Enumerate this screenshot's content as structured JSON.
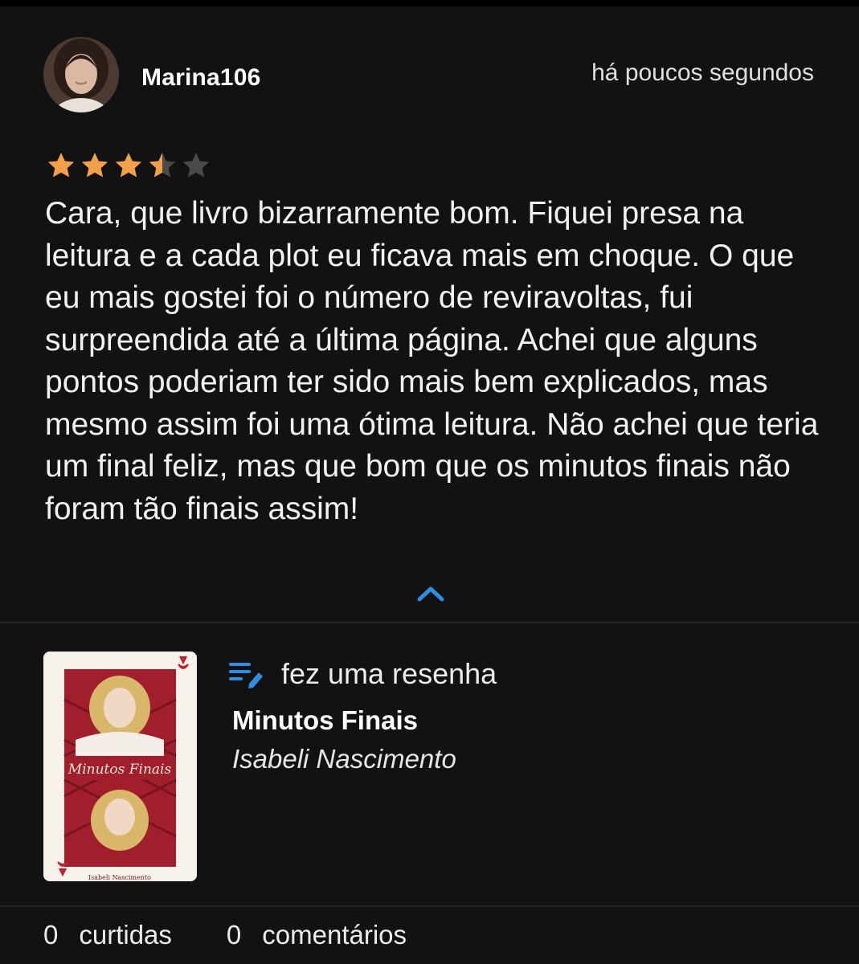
{
  "user": {
    "name": "Marina106",
    "time": "há poucos segundos"
  },
  "rating": {
    "value": 3.5,
    "max": 5
  },
  "review": {
    "text": "Cara, que livro bizarramente bom. Fiquei presa na leitura e a cada plot eu ficava mais em choque. O que eu mais gostei foi o número de reviravoltas, fui surpreendida até a última página. Achei que alguns pontos poderiam ter sido mais bem explicados, mas mesmo assim foi uma ótima leitura. Não achei que teria um final feliz, mas que bom que os minutos finais não foram tão finais assim!"
  },
  "activity": {
    "label": "fez uma resenha",
    "icon": "edit-list-icon"
  },
  "book": {
    "title": "Minutos Finais",
    "author": "Isabeli Nascimento",
    "cover_title": "Minutos Finais",
    "cover_author": "Isabeli Nascimento"
  },
  "footer": {
    "likes_count": "0",
    "likes_label": "curtidas",
    "comments_count": "0",
    "comments_label": "comentários"
  },
  "colors": {
    "background": "#121212",
    "star": "#f4a04a",
    "star_empty": "#4a4a4a",
    "accent": "#2e8de0"
  }
}
